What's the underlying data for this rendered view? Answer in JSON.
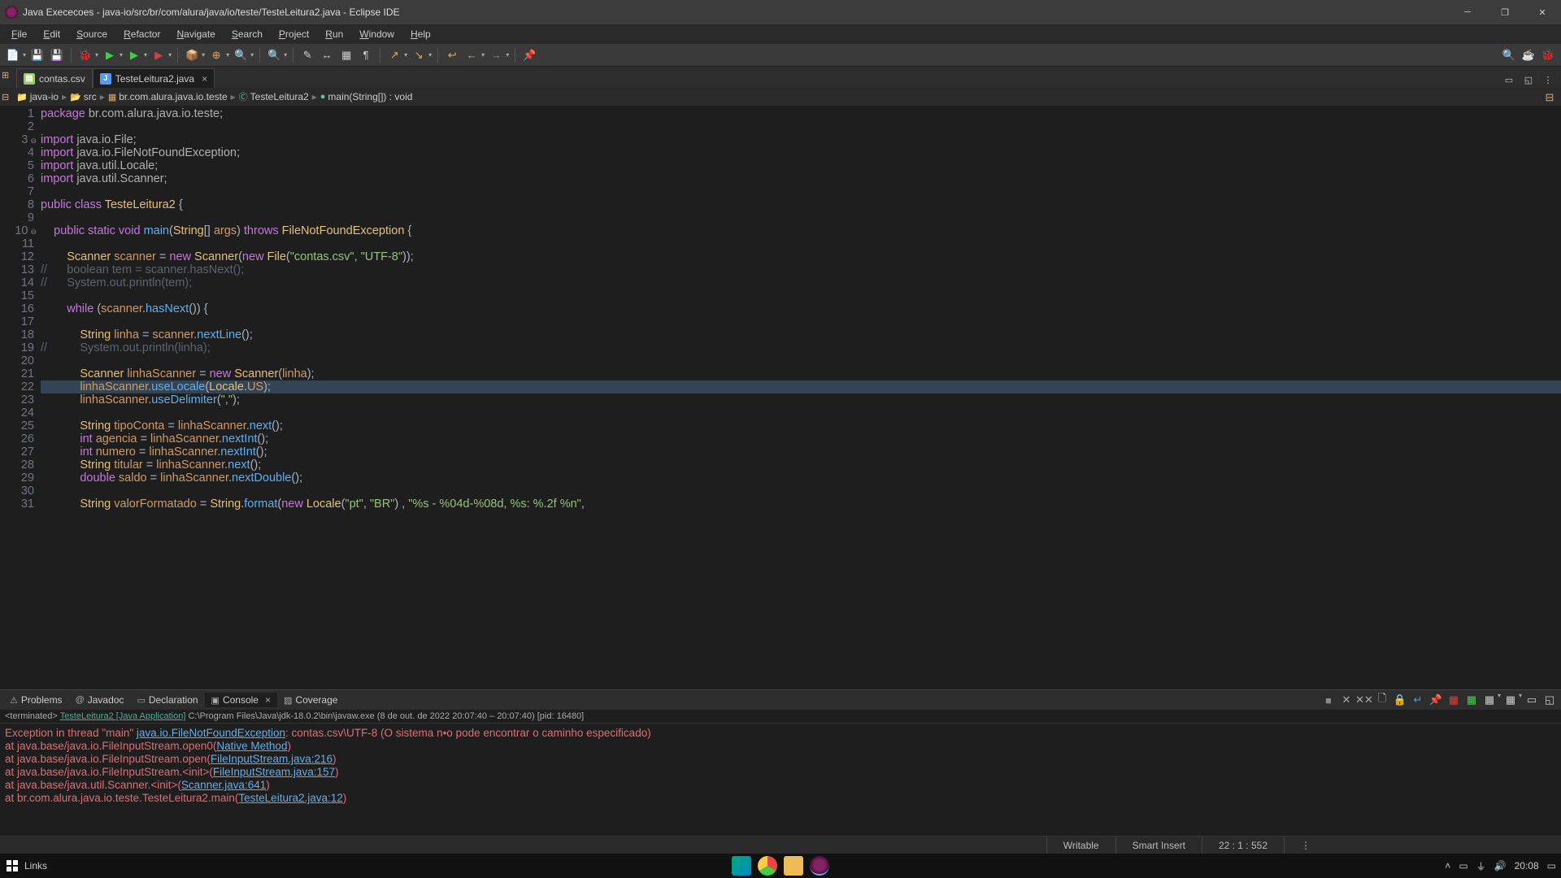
{
  "window": {
    "title": "Java Exececoes - java-io/src/br/com/alura/java/io/teste/TesteLeitura2.java - Eclipse IDE"
  },
  "menu": [
    "File",
    "Edit",
    "Source",
    "Refactor",
    "Navigate",
    "Search",
    "Project",
    "Run",
    "Window",
    "Help"
  ],
  "tabs": [
    {
      "icon": "csv",
      "label": "contas.csv",
      "active": false
    },
    {
      "icon": "java",
      "label": "TesteLeitura2.java",
      "active": true
    }
  ],
  "breadcrumb": [
    {
      "icon": "proj",
      "label": "java-io"
    },
    {
      "icon": "src",
      "label": "src"
    },
    {
      "icon": "pkg",
      "label": "br.com.alura.java.io.teste"
    },
    {
      "icon": "class",
      "label": "TesteLeitura2"
    },
    {
      "icon": "method",
      "label": "main(String[]) : void"
    }
  ],
  "code": {
    "lines": [
      {
        "n": 1,
        "tokens": [
          [
            "kw",
            "package "
          ],
          [
            "pkg",
            "br.com.alura.java.io.teste"
          ],
          [
            "txt",
            ";"
          ]
        ]
      },
      {
        "n": 2,
        "tokens": []
      },
      {
        "n": 3,
        "fold": true,
        "tokens": [
          [
            "kw",
            "import "
          ],
          [
            "pkg",
            "java.io.File"
          ],
          [
            "txt",
            ";"
          ]
        ]
      },
      {
        "n": 4,
        "tokens": [
          [
            "kw",
            "import "
          ],
          [
            "pkg",
            "java.io.FileNotFoundException"
          ],
          [
            "txt",
            ";"
          ]
        ]
      },
      {
        "n": 5,
        "tokens": [
          [
            "kw",
            "import "
          ],
          [
            "pkg",
            "java.util.Locale"
          ],
          [
            "txt",
            ";"
          ]
        ]
      },
      {
        "n": 6,
        "tokens": [
          [
            "kw",
            "import "
          ],
          [
            "pkg",
            "java.util.Scanner"
          ],
          [
            "txt",
            ";"
          ]
        ]
      },
      {
        "n": 7,
        "tokens": []
      },
      {
        "n": 8,
        "tokens": [
          [
            "kw",
            "public "
          ],
          [
            "kw",
            "class "
          ],
          [
            "class",
            "TesteLeitura2 "
          ],
          [
            "txt",
            "{"
          ]
        ]
      },
      {
        "n": 9,
        "tokens": []
      },
      {
        "n": 10,
        "fold": true,
        "tokens": [
          [
            "txt",
            "    "
          ],
          [
            "kw",
            "public "
          ],
          [
            "kw",
            "static "
          ],
          [
            "kw",
            "void "
          ],
          [
            "method",
            "main"
          ],
          [
            "txt",
            "("
          ],
          [
            "class",
            "String"
          ],
          [
            "txt",
            "[] "
          ],
          [
            "param",
            "args"
          ],
          [
            "txt",
            ") "
          ],
          [
            "kw",
            "throws "
          ],
          [
            "class",
            "FileNotFoundException "
          ],
          [
            "txt",
            "{"
          ]
        ]
      },
      {
        "n": 11,
        "tokens": []
      },
      {
        "n": 12,
        "tokens": [
          [
            "txt",
            "        "
          ],
          [
            "class",
            "Scanner "
          ],
          [
            "var",
            "scanner "
          ],
          [
            "txt",
            "= "
          ],
          [
            "kw",
            "new "
          ],
          [
            "class",
            "Scanner"
          ],
          [
            "txt",
            "("
          ],
          [
            "kw",
            "new "
          ],
          [
            "class",
            "File"
          ],
          [
            "txt",
            "("
          ],
          [
            "str",
            "\"contas.csv\""
          ],
          [
            "txt",
            ", "
          ],
          [
            "str",
            "\"UTF-8\""
          ],
          [
            "txt",
            "));"
          ]
        ]
      },
      {
        "n": 13,
        "tokens": [
          [
            "comm",
            "//      boolean "
          ],
          [
            "comm",
            "tem"
          ],
          [
            "comm",
            " = scanner.hasNext();"
          ]
        ]
      },
      {
        "n": 14,
        "tokens": [
          [
            "comm",
            "//      System.out.println("
          ],
          [
            "comm",
            "tem"
          ],
          [
            "comm",
            ");"
          ]
        ]
      },
      {
        "n": 15,
        "tokens": []
      },
      {
        "n": 16,
        "tokens": [
          [
            "txt",
            "        "
          ],
          [
            "kw",
            "while "
          ],
          [
            "txt",
            "("
          ],
          [
            "var",
            "scanner"
          ],
          [
            "txt",
            "."
          ],
          [
            "method",
            "hasNext"
          ],
          [
            "txt",
            "()) {"
          ]
        ]
      },
      {
        "n": 17,
        "tokens": []
      },
      {
        "n": 18,
        "tokens": [
          [
            "txt",
            "            "
          ],
          [
            "class",
            "String "
          ],
          [
            "var",
            "linha "
          ],
          [
            "txt",
            "= "
          ],
          [
            "var",
            "scanner"
          ],
          [
            "txt",
            "."
          ],
          [
            "method",
            "nextLine"
          ],
          [
            "txt",
            "();"
          ]
        ]
      },
      {
        "n": 19,
        "tokens": [
          [
            "comm",
            "//          System.out.println("
          ],
          [
            "comm",
            "linha"
          ],
          [
            "comm",
            ");"
          ]
        ]
      },
      {
        "n": 20,
        "tokens": []
      },
      {
        "n": 21,
        "tokens": [
          [
            "txt",
            "            "
          ],
          [
            "class",
            "Scanner "
          ],
          [
            "var",
            "linhaScanner "
          ],
          [
            "txt",
            "= "
          ],
          [
            "kw",
            "new "
          ],
          [
            "class",
            "Scanner"
          ],
          [
            "txt",
            "("
          ],
          [
            "var",
            "linha"
          ],
          [
            "txt",
            ");"
          ]
        ]
      },
      {
        "n": 22,
        "hl": true,
        "tokens": [
          [
            "txt",
            "            "
          ],
          [
            "var",
            "linhaScanner"
          ],
          [
            "txt",
            "."
          ],
          [
            "method",
            "useLocale"
          ],
          [
            "txt",
            "("
          ],
          [
            "class",
            "Locale"
          ],
          [
            "txt",
            "."
          ],
          [
            "var",
            "US"
          ],
          [
            "txt",
            ");"
          ]
        ]
      },
      {
        "n": 23,
        "tokens": [
          [
            "txt",
            "            "
          ],
          [
            "var",
            "linhaScanner"
          ],
          [
            "txt",
            "."
          ],
          [
            "method",
            "useDelimiter"
          ],
          [
            "txt",
            "("
          ],
          [
            "str",
            "\",\""
          ],
          [
            "txt",
            ");"
          ]
        ]
      },
      {
        "n": 24,
        "tokens": []
      },
      {
        "n": 25,
        "tokens": [
          [
            "txt",
            "            "
          ],
          [
            "class",
            "String "
          ],
          [
            "var",
            "tipoConta "
          ],
          [
            "txt",
            "= "
          ],
          [
            "var",
            "linhaScanner"
          ],
          [
            "txt",
            "."
          ],
          [
            "method",
            "next"
          ],
          [
            "txt",
            "();"
          ]
        ]
      },
      {
        "n": 26,
        "tokens": [
          [
            "txt",
            "            "
          ],
          [
            "kw",
            "int "
          ],
          [
            "var",
            "agencia "
          ],
          [
            "txt",
            "= "
          ],
          [
            "var",
            "linhaScanner"
          ],
          [
            "txt",
            "."
          ],
          [
            "method",
            "nextInt"
          ],
          [
            "txt",
            "();"
          ]
        ]
      },
      {
        "n": 27,
        "tokens": [
          [
            "txt",
            "            "
          ],
          [
            "kw",
            "int "
          ],
          [
            "var",
            "numero "
          ],
          [
            "txt",
            "= "
          ],
          [
            "var",
            "linhaScanner"
          ],
          [
            "txt",
            "."
          ],
          [
            "method",
            "nextInt"
          ],
          [
            "txt",
            "();"
          ]
        ]
      },
      {
        "n": 28,
        "tokens": [
          [
            "txt",
            "            "
          ],
          [
            "class",
            "String "
          ],
          [
            "var",
            "titular "
          ],
          [
            "txt",
            "= "
          ],
          [
            "var",
            "linhaScanner"
          ],
          [
            "txt",
            "."
          ],
          [
            "method",
            "next"
          ],
          [
            "txt",
            "();"
          ]
        ]
      },
      {
        "n": 29,
        "tokens": [
          [
            "txt",
            "            "
          ],
          [
            "kw",
            "double "
          ],
          [
            "var",
            "saldo "
          ],
          [
            "txt",
            "= "
          ],
          [
            "var",
            "linhaScanner"
          ],
          [
            "txt",
            "."
          ],
          [
            "method",
            "nextDouble"
          ],
          [
            "txt",
            "();"
          ]
        ]
      },
      {
        "n": 30,
        "tokens": []
      },
      {
        "n": 31,
        "tokens": [
          [
            "txt",
            "            "
          ],
          [
            "class",
            "String "
          ],
          [
            "var",
            "valorFormatado "
          ],
          [
            "txt",
            "= "
          ],
          [
            "class",
            "String"
          ],
          [
            "txt",
            "."
          ],
          [
            "method",
            "format"
          ],
          [
            "txt",
            "("
          ],
          [
            "kw",
            "new "
          ],
          [
            "class",
            "Locale"
          ],
          [
            "txt",
            "("
          ],
          [
            "str",
            "\"pt\""
          ],
          [
            "txt",
            ", "
          ],
          [
            "str",
            "\"BR\""
          ],
          [
            "txt",
            ") , "
          ],
          [
            "str",
            "\"%s - %04d-%08d, %s: %.2f %n\""
          ],
          [
            "txt",
            ","
          ]
        ]
      }
    ]
  },
  "bottomTabs": [
    {
      "icon": "warn",
      "label": "Problems",
      "active": false
    },
    {
      "icon": "doc",
      "label": "Javadoc",
      "active": false
    },
    {
      "icon": "decl",
      "label": "Declaration",
      "active": false
    },
    {
      "icon": "cons",
      "label": "Console",
      "active": true,
      "closable": true
    },
    {
      "icon": "cov",
      "label": "Coverage",
      "active": false
    }
  ],
  "terminatedLine": {
    "pre": "<terminated> ",
    "link": "TesteLeitura2 [Java Application]",
    "post": " C:\\Program Files\\Java\\jdk-18.0.2\\bin\\javaw.exe  (8 de out. de 2022 20:07:40 – 20:07:40) [pid: 16480]"
  },
  "console": [
    [
      [
        "err",
        "Exception in thread \"main\" "
      ],
      [
        "errlink",
        "java.io.FileNotFoundException"
      ],
      [
        "err",
        ": contas.csv\\UTF-8 (O sistema n•o pode encontrar o caminho especificado)"
      ]
    ],
    [
      [
        "err",
        "        at java.base/java.io.FileInputStream.open0("
      ],
      [
        "errlink",
        "Native Method"
      ],
      [
        "err",
        ")"
      ]
    ],
    [
      [
        "err",
        "        at java.base/java.io.FileInputStream.open("
      ],
      [
        "errlink",
        "FileInputStream.java:216"
      ],
      [
        "err",
        ")"
      ]
    ],
    [
      [
        "err",
        "        at java.base/java.io.FileInputStream.<init>("
      ],
      [
        "errlink",
        "FileInputStream.java:157"
      ],
      [
        "err",
        ")"
      ]
    ],
    [
      [
        "err",
        "        at java.base/java.util.Scanner.<init>("
      ],
      [
        "errlink",
        "Scanner.java:641"
      ],
      [
        "err",
        ")"
      ]
    ],
    [
      [
        "err",
        "        at br.com.alura.java.io.teste.TesteLeitura2.main("
      ],
      [
        "errlink",
        "TesteLeitura2.java:12"
      ],
      [
        "err",
        ")"
      ]
    ]
  ],
  "status": {
    "writable": "Writable",
    "insert": "Smart Insert",
    "pos": "22 : 1 : 552"
  },
  "taskbar": {
    "search": "Links",
    "clock": "20:08"
  }
}
